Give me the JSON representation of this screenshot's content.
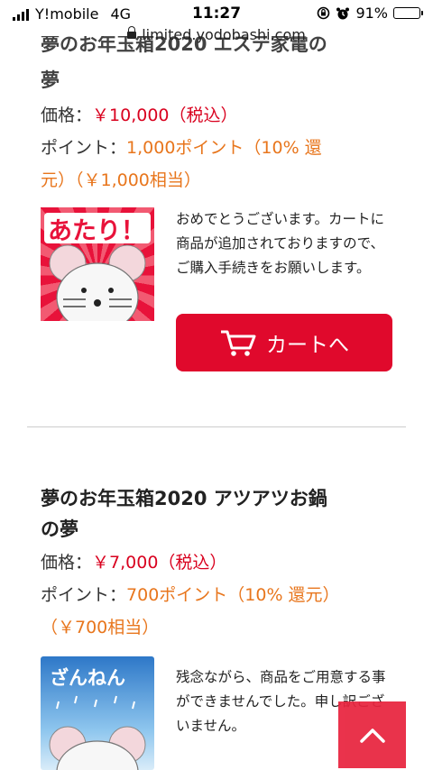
{
  "status": {
    "carrier": "Y!mobile",
    "network": "4G",
    "time": "11:27",
    "battery": "91%",
    "battery_level": 0.91,
    "url": "limited.yodobashi.com"
  },
  "products": [
    {
      "title_line1": "夢のお年玉箱2020 エステ家電の",
      "title_line2": "夢",
      "price_label": "価格：",
      "price_value": "￥10,000（税込）",
      "point_label": "ポイント：",
      "point_value_line1": "1,000ポイント（10% 還",
      "point_value_line2": "元）（￥1,000相当）",
      "result_image_text": "あたり！",
      "result_message": "おめでとうございます。カートに商品が追加されておりますので、ご購入手続きをお願いします。",
      "cart_button_label": "カートへ"
    },
    {
      "title_line1": "夢のお年玉箱2020 アツアツお鍋",
      "title_line2": "の夢",
      "price_label": "価格：",
      "price_value": "￥7,000（税込）",
      "point_label": "ポイント：",
      "point_value_line1": "700ポイント（10% 還元）",
      "point_value_line2": "（￥700相当）",
      "result_image_text": "ざんねん",
      "result_message": "残念ながら、商品をご用意する事ができませんでした。申し訳ございません。"
    }
  ],
  "icons": {
    "cart": "cart-icon",
    "back_to_top": "chevron-up-icon"
  },
  "colors": {
    "price": "#d9021f",
    "point": "#e8761d",
    "cart_button": "#e0092c",
    "back_to_top": "#e8243e"
  }
}
